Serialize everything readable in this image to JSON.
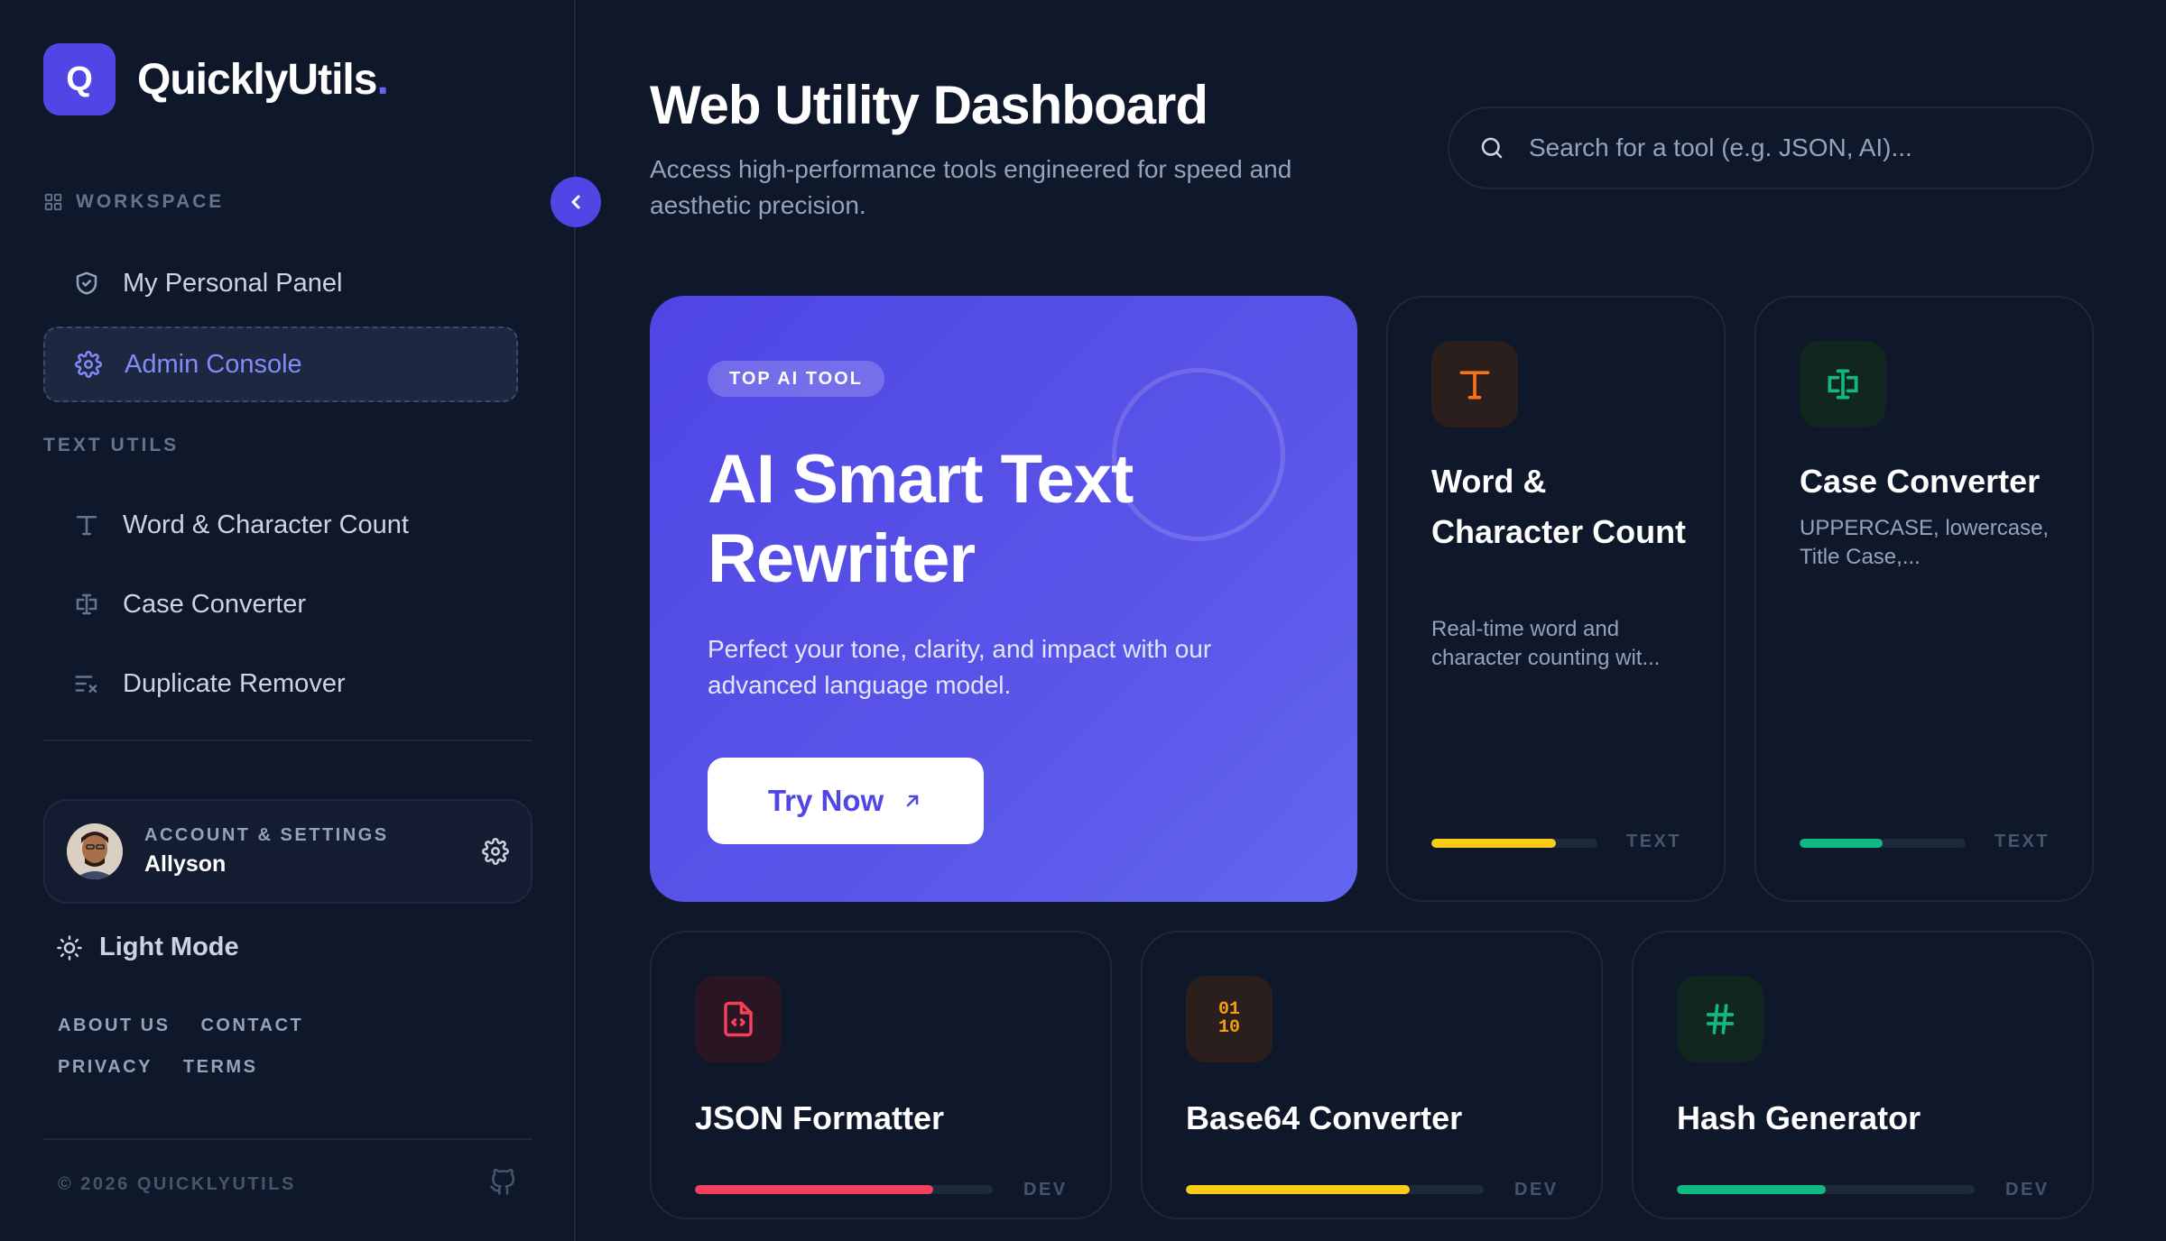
{
  "app": {
    "logo_letter": "Q",
    "name": "QuicklyUtils",
    "dot": "."
  },
  "sidebar": {
    "workspace_label": "WORKSPACE",
    "workspace_items": [
      {
        "label": "My Personal Panel",
        "icon": "shield-check-icon"
      },
      {
        "label": "Admin Console",
        "icon": "gear-icon",
        "active": true
      }
    ],
    "text_utils_label": "TEXT UTILS",
    "text_items": [
      {
        "label": "Word & Character Count",
        "icon": "type-icon"
      },
      {
        "label": "Case Converter",
        "icon": "text-cursor-icon"
      },
      {
        "label": "Duplicate Remover",
        "icon": "list-filter-icon"
      }
    ],
    "account": {
      "label": "ACCOUNT & SETTINGS",
      "name": "Allyson"
    },
    "mode_label": "Light Mode",
    "links_row1": [
      "ABOUT US",
      "CONTACT"
    ],
    "links_row2": [
      "PRIVACY",
      "TERMS"
    ],
    "copyright": "© 2026 QUICKLYUTILS"
  },
  "main": {
    "title": "Web Utility Dashboard",
    "subtitle": "Access high-performance tools engineered for speed and aesthetic precision.",
    "search_placeholder": "Search for a tool (e.g. JSON, AI)..."
  },
  "hero": {
    "badge": "TOP AI TOOL",
    "title": "AI Smart Text Rewriter",
    "description": "Perfect your tone, clarity, and impact with our advanced language model.",
    "cta": "Try Now"
  },
  "cards": [
    {
      "title": "Word & Character Count",
      "description": "Real-time word and character counting wit...",
      "tag": "TEXT",
      "progress": 0.75,
      "color": "#facc15",
      "icon": "type-icon"
    },
    {
      "title": "Case Converter",
      "description": "UPPERCASE, lowercase, Title Case,...",
      "tag": "TEXT",
      "progress": 0.5,
      "color": "#10b981",
      "icon": "text-cursor-icon"
    },
    {
      "title": "JSON Formatter",
      "tag": "DEV",
      "progress": 0.8,
      "color": "#f43f5e",
      "icon": "file-code-icon"
    },
    {
      "title": "Base64 Converter",
      "icon_text": "01\n10",
      "tag": "DEV",
      "progress": 0.75,
      "color": "#facc15",
      "icon": "binary-icon"
    },
    {
      "title": "Hash Generator",
      "tag": "DEV",
      "progress": 0.5,
      "color": "#10b981",
      "icon": "hash-icon"
    }
  ]
}
